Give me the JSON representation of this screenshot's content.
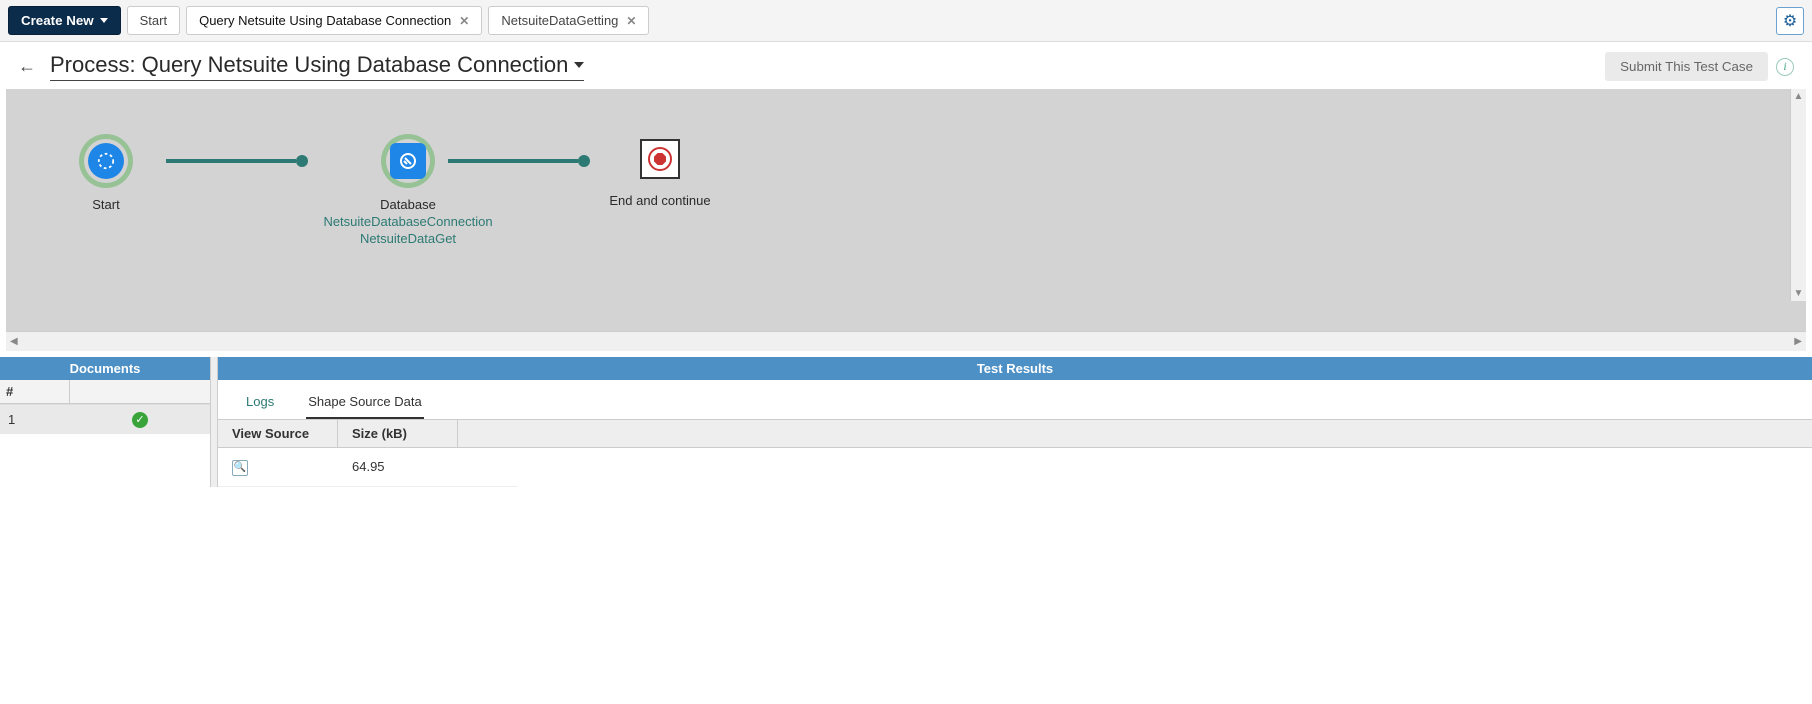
{
  "toolbar": {
    "create_new": "Create New",
    "tabs": [
      {
        "label": "Start",
        "closable": false,
        "active": false
      },
      {
        "label": "Query Netsuite Using Database Connection",
        "closable": true,
        "active": true
      },
      {
        "label": "NetsuiteDataGetting",
        "closable": true,
        "active": false
      }
    ]
  },
  "header": {
    "title_prefix": "Process: ",
    "title": "Query Netsuite Using Database Connection",
    "submit": "Submit This Test Case"
  },
  "pipeline": {
    "nodes": [
      {
        "label": "Start",
        "subs": [],
        "type": "start"
      },
      {
        "label": "Database",
        "subs": [
          "NetsuiteDatabaseConnection",
          "NetsuiteDataGet"
        ],
        "type": "database"
      },
      {
        "label": "End and continue",
        "subs": [],
        "type": "stop"
      }
    ]
  },
  "documents": {
    "header": "Documents",
    "col_num": "#",
    "rows": [
      {
        "index": "1",
        "status": "ok"
      }
    ]
  },
  "results": {
    "header": "Test Results",
    "subtabs": {
      "logs": "Logs",
      "shape": "Shape Source Data",
      "active": "shape"
    },
    "columns": {
      "view": "View Source",
      "size": "Size (kB)"
    },
    "rows": [
      {
        "size": "64.95"
      }
    ]
  }
}
